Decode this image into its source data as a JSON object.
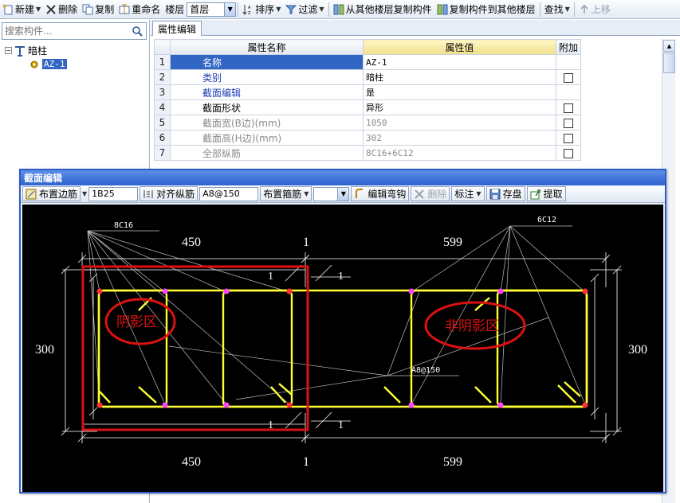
{
  "toolbar": {
    "new_label": "新建",
    "delete_label": "删除",
    "copy_label": "复制",
    "rename_label": "重命名",
    "floor_label": "楼层",
    "floor_value": "首层",
    "sort_label": "排序",
    "filter_label": "过滤",
    "copy_from_other_floor": "从其他楼层复制构件",
    "copy_to_other_floor": "复制构件到其他楼层",
    "find_label": "查找",
    "move_up_label": "上移"
  },
  "sidebar": {
    "search_placeholder": "搜索构件...",
    "tree": {
      "root_label": "暗柱",
      "root_expander": "−",
      "child_label": "AZ-1"
    }
  },
  "props_panel": {
    "tab_label": "属性编辑",
    "headers": {
      "name": "属性名称",
      "value": "属性值",
      "add": "附加"
    },
    "rows": [
      {
        "num": "1",
        "name": "名称",
        "value": "AZ-1",
        "checkbox": false,
        "style": "selected"
      },
      {
        "num": "2",
        "name": "类别",
        "value": "暗柱",
        "checkbox": true,
        "style": "blue"
      },
      {
        "num": "3",
        "name": "截面编辑",
        "value": "是",
        "checkbox": false,
        "style": "blue"
      },
      {
        "num": "4",
        "name": "截面形状",
        "value": "异形",
        "checkbox": true,
        "style": "normal"
      },
      {
        "num": "5",
        "name": "截面宽(B边)(mm)",
        "value": "1050",
        "checkbox": true,
        "style": "gray"
      },
      {
        "num": "6",
        "name": "截面高(H边)(mm)",
        "value": "302",
        "checkbox": true,
        "style": "gray"
      },
      {
        "num": "7",
        "name": "全部纵筋",
        "value": "8C16+6C12",
        "checkbox": true,
        "style": "gray"
      }
    ]
  },
  "section_dialog": {
    "title": "截面编辑",
    "arrange_edge_label": "布置边筋",
    "edge_rebar_value": "1B25",
    "align_rebar_label": "对齐纵筋",
    "stirrup_value": "A8@150",
    "arrange_stirrup_label": "布置箍筋",
    "edit_bend_label": "编辑弯钩",
    "delete_label": "删除",
    "annotate_label": "标注",
    "save_label": "存盘",
    "extract_label": "提取"
  },
  "drawing": {
    "label_8c16": "8C16",
    "label_6c12": "6C12",
    "label_stirrup": "A8@150",
    "dim_top_left": "450",
    "dim_top_mid": "1",
    "dim_top_right": "599",
    "dim_bottom_left": "450",
    "dim_bottom_mid": "1",
    "dim_bottom_right": "599",
    "dim_left": "300",
    "dim_right": "300",
    "dim_small_one": "1",
    "shadow_zone_label": "阴影区",
    "non_shadow_zone_label": "非阴影区",
    "colors": {
      "rebar": "#ffff33",
      "dim_line": "#ffffff",
      "corner_bar": "#ff3333",
      "mid_bar": "#ff44ff",
      "annotation": "#cc1111"
    }
  }
}
